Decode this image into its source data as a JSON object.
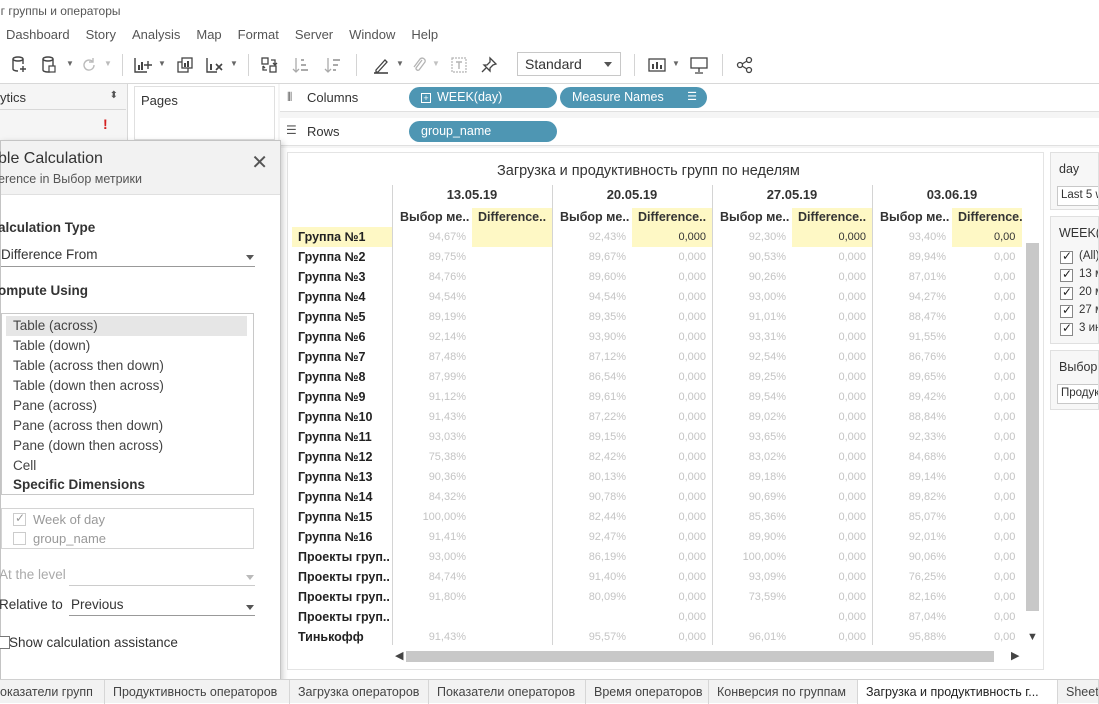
{
  "window": {
    "title": "нг группы и операторы"
  },
  "menu": [
    "Dashboard",
    "Story",
    "Analysis",
    "Map",
    "Format",
    "Server",
    "Window",
    "Help"
  ],
  "toolbar": {
    "fit_select": "Standard",
    "icons": [
      "new-datasource-icon",
      "datasource-icon",
      "refresh-icon",
      "new-worksheet-icon",
      "duplicate-icon",
      "clear-icon",
      "swap-icon",
      "sort-asc-icon",
      "sort-desc-icon",
      "highlight-icon",
      "group-icon",
      "label-icon",
      "pin-icon",
      "show-me-icon",
      "presentation-icon",
      "share-icon"
    ]
  },
  "left": {
    "analytics_label": "ytics",
    "warning": "!",
    "pages_label": "Pages"
  },
  "shelves": {
    "columns_label": "Columns",
    "rows_label": "Rows",
    "columns_pills": [
      "WEEK(day)",
      "Measure Names"
    ],
    "rows_pills": [
      "group_name"
    ]
  },
  "calc_dialog": {
    "title": "ble Calculation",
    "subtitle": "erence in Выбор метрики",
    "calc_type_label": "alculation Type",
    "calc_type_value": "Difference From",
    "compute_label": "ompute Using",
    "compute_items": [
      "Table (across)",
      "Table (down)",
      "Table (across then down)",
      "Table (down then across)",
      "Pane (across)",
      "Pane (across then down)",
      "Pane (down then across)",
      "Cell",
      "Specific Dimensions"
    ],
    "selected_compute": "Table (across)",
    "dims": [
      {
        "label": "Week of day",
        "checked": true
      },
      {
        "label": "group_name",
        "checked": false
      }
    ],
    "level_label": "At the level",
    "relative_label": "Relative to",
    "relative_value": "Previous",
    "assist_label": "Show calculation assistance"
  },
  "viz": {
    "title": "Загрузка и продуктивность групп по неделям",
    "weeks": [
      "13.05.19",
      "20.05.19",
      "27.05.19",
      "03.06.19"
    ],
    "col_metric": "Выбор ме..",
    "col_diff": "Difference..",
    "rows": [
      {
        "name": "Группа №1",
        "v": [
          "94,67%",
          "",
          "92,43%",
          "0,000",
          "92,30%",
          "0,000",
          "93,40%",
          "0,00"
        ]
      },
      {
        "name": "Группа №2",
        "v": [
          "89,75%",
          "",
          "89,67%",
          "0,000",
          "90,53%",
          "0,000",
          "89,94%",
          "0,00"
        ]
      },
      {
        "name": "Группа №3",
        "v": [
          "84,76%",
          "",
          "89,60%",
          "0,000",
          "90,26%",
          "0,000",
          "87,01%",
          "0,00"
        ]
      },
      {
        "name": "Группа №4",
        "v": [
          "94,54%",
          "",
          "94,54%",
          "0,000",
          "93,00%",
          "0,000",
          "94,27%",
          "0,00"
        ]
      },
      {
        "name": "Группа №5",
        "v": [
          "89,19%",
          "",
          "89,35%",
          "0,000",
          "91,01%",
          "0,000",
          "88,47%",
          "0,00"
        ]
      },
      {
        "name": "Группа №6",
        "v": [
          "92,14%",
          "",
          "93,90%",
          "0,000",
          "93,31%",
          "0,000",
          "91,55%",
          "0,00"
        ]
      },
      {
        "name": "Группа №7",
        "v": [
          "87,48%",
          "",
          "87,12%",
          "0,000",
          "92,54%",
          "0,000",
          "86,76%",
          "0,00"
        ]
      },
      {
        "name": "Группа №8",
        "v": [
          "87,99%",
          "",
          "86,54%",
          "0,000",
          "89,25%",
          "0,000",
          "89,65%",
          "0,00"
        ]
      },
      {
        "name": "Группа №9",
        "v": [
          "91,12%",
          "",
          "89,61%",
          "0,000",
          "89,54%",
          "0,000",
          "89,42%",
          "0,00"
        ]
      },
      {
        "name": "Группа №10",
        "v": [
          "91,43%",
          "",
          "87,22%",
          "0,000",
          "89,02%",
          "0,000",
          "88,84%",
          "0,00"
        ]
      },
      {
        "name": "Группа №11",
        "v": [
          "93,03%",
          "",
          "89,15%",
          "0,000",
          "93,65%",
          "0,000",
          "92,33%",
          "0,00"
        ]
      },
      {
        "name": "Группа №12",
        "v": [
          "75,38%",
          "",
          "82,42%",
          "0,000",
          "83,02%",
          "0,000",
          "84,68%",
          "0,00"
        ]
      },
      {
        "name": "Группа №13",
        "v": [
          "90,36%",
          "",
          "80,13%",
          "0,000",
          "89,18%",
          "0,000",
          "89,14%",
          "0,00"
        ]
      },
      {
        "name": "Группа №14",
        "v": [
          "84,32%",
          "",
          "90,78%",
          "0,000",
          "90,69%",
          "0,000",
          "89,82%",
          "0,00"
        ]
      },
      {
        "name": "Группа №15",
        "v": [
          "100,00%",
          "",
          "82,44%",
          "0,000",
          "85,36%",
          "0,000",
          "85,07%",
          "0,00"
        ]
      },
      {
        "name": "Группа №16",
        "v": [
          "91,41%",
          "",
          "92,47%",
          "0,000",
          "89,90%",
          "0,000",
          "92,01%",
          "0,00"
        ]
      },
      {
        "name": "Проекты груп..",
        "v": [
          "93,00%",
          "",
          "86,19%",
          "0,000",
          "100,00%",
          "0,000",
          "90,06%",
          "0,00"
        ]
      },
      {
        "name": "Проекты груп..",
        "v": [
          "84,74%",
          "",
          "91,40%",
          "0,000",
          "93,09%",
          "0,000",
          "76,25%",
          "0,00"
        ]
      },
      {
        "name": "Проекты груп..",
        "v": [
          "91,80%",
          "",
          "80,09%",
          "0,000",
          "73,59%",
          "0,000",
          "82,16%",
          "0,00"
        ]
      },
      {
        "name": "Проекты груп..",
        "v": [
          "",
          "",
          "",
          "0,000",
          "",
          "0,000",
          "87,04%",
          "0,00"
        ]
      },
      {
        "name": "Тинькофф",
        "v": [
          "91,43%",
          "",
          "95,57%",
          "0,000",
          "96,01%",
          "0,000",
          "95,88%",
          "0,00"
        ]
      }
    ]
  },
  "right": {
    "day_title": "day",
    "day_select": "Last 5 w",
    "week_title": "WEEK(d",
    "week_items": [
      {
        "label": "(All)",
        "checked": true
      },
      {
        "label": "13 м",
        "checked": true
      },
      {
        "label": "20 м",
        "checked": true
      },
      {
        "label": "27 м",
        "checked": true
      },
      {
        "label": "3 ин",
        "checked": true
      }
    ],
    "metric_title": "Выбор",
    "metric_select": "Продук"
  },
  "tabs": [
    "оказатели групп",
    "Продуктивность операторов",
    "Загрузка операторов",
    "Показатели операторов",
    "Время операторов",
    "Конверсия по группам",
    "Загрузка и продуктивность г...",
    "Sheet"
  ],
  "active_tab": "Загрузка и продуктивность г..."
}
